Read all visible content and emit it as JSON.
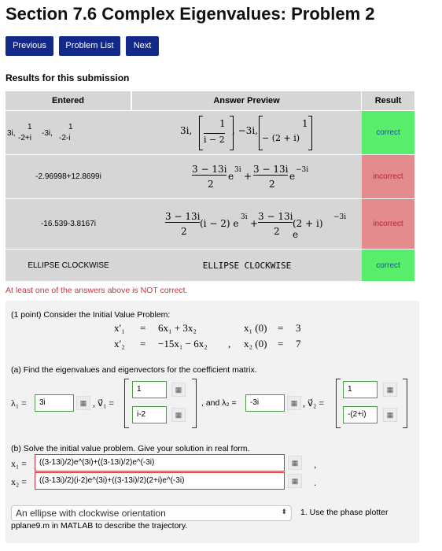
{
  "page_title": "Section 7.6 Complex Eigenvalues: Problem 2",
  "nav": {
    "previous": "Previous",
    "problem_list": "Problem List",
    "next": "Next"
  },
  "results_heading": "Results for this submission",
  "table": {
    "headers": {
      "entered": "Entered",
      "preview": "Answer Preview",
      "result": "Result"
    },
    "rows": [
      {
        "entered": {
          "a": "3i,",
          "b": "1",
          "c": "-2+i",
          "d": "-3i,",
          "e": "1",
          "f": "-2-i"
        },
        "preview": {
          "a": "3i,",
          "b": "1",
          "c": "i − 2",
          "d": ", −3i,",
          "e": "1",
          "f": "− (2 + i)"
        },
        "result": "correct"
      },
      {
        "entered": "-2.96998+12.8699i",
        "preview": {
          "n1": "3 − 13i",
          "d1": "2",
          "t1": "e",
          "s1": "3i",
          "plus": "+",
          "n2": "3 − 13i",
          "d2": "2",
          "t2": "e",
          "s2": "−3i"
        },
        "result": "incorrect"
      },
      {
        "entered": "-16.539-3.8167i",
        "preview": {
          "n1": "3 − 13i",
          "d1": "2",
          "t1": "(i − 2) e",
          "s1": "3i",
          "plus": "+",
          "n2": "3 − 13i",
          "d2": "2",
          "t2": "(2 + i) e",
          "s2": "−3i"
        },
        "result": "incorrect"
      },
      {
        "entered": "ELLIPSE CLOCKWISE",
        "preview": "ELLIPSE CLOCKWISE",
        "result": "correct"
      }
    ]
  },
  "warning": "At least one of the answers above is NOT correct.",
  "problem": {
    "intro": "(1 point) Consider the Initial Value Problem:",
    "eq1": {
      "lhs": "x′₁",
      "eq": "=",
      "rhs": "6x₁ + 3x₂",
      "ic": "x₁ (0)",
      "ic_eq": "=",
      "ic_val": "3"
    },
    "eq2": {
      "lhs": "x′₂",
      "eq": "=",
      "rhs": "−15x₁ − 6x₂",
      "comma": ",",
      "ic": "x₂ (0)",
      "ic_eq": "=",
      "ic_val": "7"
    },
    "part_a": "(a) Find the eigenvalues and eigenvectors for the coefficient matrix.",
    "lambda1_label": "λ₁ =",
    "lambda1_value": "3i",
    "v1_label": ", v⃗₁ =",
    "v1_top": "1",
    "v1_bottom": "i-2",
    "and_label": ", and λ₂ =",
    "lambda2_value": "-3i",
    "v2_label": ", v⃗₂ =",
    "v2_top": "1",
    "v2_bottom": "-(2+i)",
    "part_b": "(b) Solve the initial value problem. Give your solution in real form.",
    "x1_label": "x₁ =",
    "x1_value": "((3-13i)/2)e^(3i)+((3-13i)/2)e^(-3i)",
    "x2_label": "x₂ =",
    "x2_value": "((3-13i)/2)(i-2)e^(3i)+((3-13i)/2)(2+i)e^(-3i)",
    "trailing_comma": ",",
    "trailing_period": ".",
    "select_value": "An ellipse with clockwise orientation",
    "select_note": "1. Use the phase plotter",
    "select_note2": "pplane9.m in MATLAB to describe the trajectory."
  },
  "colors": {
    "nav": "#13298a",
    "correct": "#59ed6c",
    "incorrect": "#e48b8e",
    "warning": "#c9343a"
  }
}
